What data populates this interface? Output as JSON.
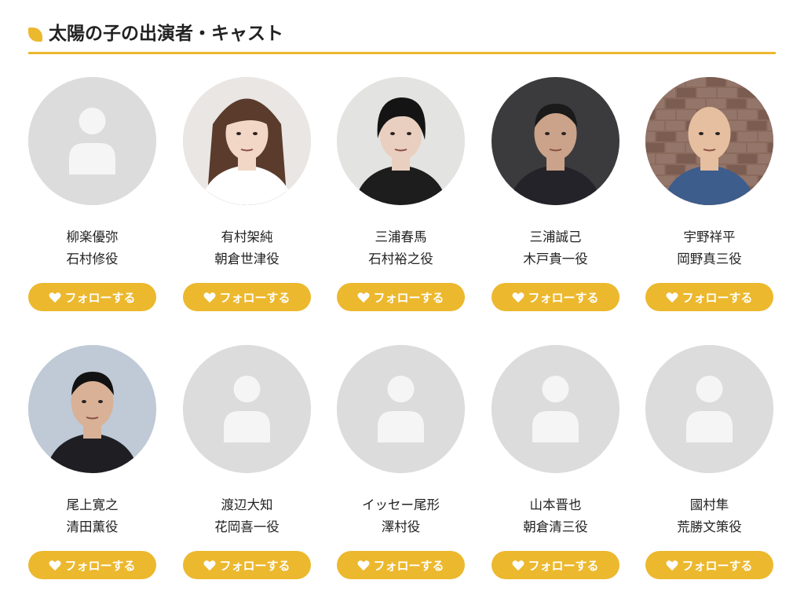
{
  "section": {
    "title": "太陽の子の出演者・キャスト",
    "accent_color": "#ecb82e"
  },
  "follow_label": "フォローする",
  "cast": [
    {
      "name": "柳楽優弥",
      "role": "石村修役",
      "photo": "placeholder-person-icon"
    },
    {
      "name": "有村架純",
      "role": "朝倉世津役",
      "photo": "portrait-photo"
    },
    {
      "name": "三浦春馬",
      "role": "石村裕之役",
      "photo": "portrait-photo"
    },
    {
      "name": "三浦誠己",
      "role": "木戸貴一役",
      "photo": "portrait-photo"
    },
    {
      "name": "宇野祥平",
      "role": "岡野真三役",
      "photo": "portrait-photo"
    },
    {
      "name": "尾上寛之",
      "role": "清田薫役",
      "photo": "portrait-photo"
    },
    {
      "name": "渡辺大知",
      "role": "花岡喜一役",
      "photo": "placeholder-person-icon"
    },
    {
      "name": "イッセー尾形",
      "role": "澤村役",
      "photo": "placeholder-person-icon"
    },
    {
      "name": "山本晋也",
      "role": "朝倉清三役",
      "photo": "placeholder-person-icon"
    },
    {
      "name": "國村隼",
      "role": "荒勝文策役",
      "photo": "placeholder-person-icon"
    }
  ]
}
